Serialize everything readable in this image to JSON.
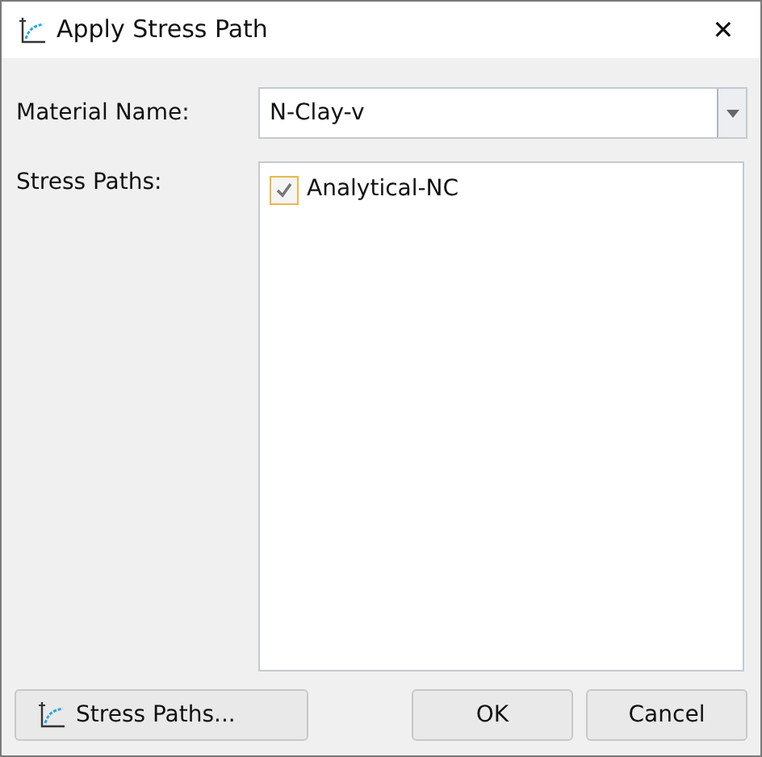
{
  "window": {
    "title": "Apply Stress Path",
    "close": "✕"
  },
  "material": {
    "label": "Material Name:",
    "value": "N-Clay-v"
  },
  "stress_paths": {
    "label": "Stress Paths:",
    "items": [
      {
        "label": "Analytical-NC",
        "checked": true
      }
    ]
  },
  "buttons": [
    {
      "kind": "tool",
      "label": "Stress Paths..."
    },
    {
      "kind": "plain",
      "label": "OK"
    },
    {
      "kind": "plain",
      "label": "Cancel"
    }
  ]
}
